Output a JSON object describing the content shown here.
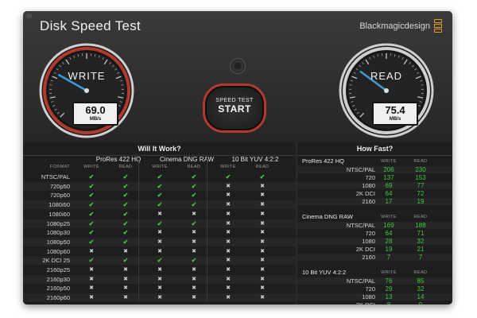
{
  "window": {
    "title": "Disk Speed Test",
    "brand": "Blackmagicdesign",
    "accent_red": "#b23a2d",
    "needle_blue": "#3f9bd8",
    "check_green": "#3ec93e",
    "icons": {
      "settings": "gear-icon",
      "close": "close-icon",
      "logo": "brand-logo-icon"
    }
  },
  "write_gauge": {
    "label": "WRITE",
    "value": "69.0",
    "unit": "MB/s"
  },
  "read_gauge": {
    "label": "READ",
    "value": "75.4",
    "unit": "MB/s"
  },
  "start_button": {
    "line1": "SPEED TEST",
    "line2": "START"
  },
  "will_it_work": {
    "title": "Will It Work?",
    "format_header": "FORMAT",
    "groups": [
      {
        "name": "ProRes 422 HQ",
        "write": "WRITE",
        "read": "READ"
      },
      {
        "name": "Cinema DNG RAW",
        "write": "WRITE",
        "read": "READ"
      },
      {
        "name": "10 Bit YUV 4:2:2",
        "write": "WRITE",
        "read": "READ"
      }
    ],
    "rows": [
      {
        "format": "NTSC/PAL",
        "marks": [
          "✔",
          "✔",
          "✔",
          "✔",
          "✔",
          "✔"
        ]
      },
      {
        "format": "720p50",
        "marks": [
          "✔",
          "✔",
          "✔",
          "✔",
          "✖",
          "✖"
        ]
      },
      {
        "format": "720p60",
        "marks": [
          "✔",
          "✔",
          "✔",
          "✔",
          "✖",
          "✖"
        ]
      },
      {
        "format": "1080i50",
        "marks": [
          "✔",
          "✔",
          "✔",
          "✔",
          "✖",
          "✖"
        ]
      },
      {
        "format": "1080i60",
        "marks": [
          "✔",
          "✔",
          "✖",
          "✖",
          "✖",
          "✖"
        ]
      },
      {
        "format": "1080p25",
        "marks": [
          "✔",
          "✔",
          "✔",
          "✔",
          "✖",
          "✖"
        ]
      },
      {
        "format": "1080p30",
        "marks": [
          "✔",
          "✔",
          "✖",
          "✖",
          "✖",
          "✖"
        ]
      },
      {
        "format": "1080p50",
        "marks": [
          "✔",
          "✔",
          "✖",
          "✖",
          "✖",
          "✖"
        ]
      },
      {
        "format": "1080p60",
        "marks": [
          "✖",
          "✖",
          "✖",
          "✖",
          "✖",
          "✖"
        ]
      },
      {
        "format": "2K DCI 25",
        "marks": [
          "✔",
          "✔",
          "✔",
          "✔",
          "✖",
          "✖"
        ]
      },
      {
        "format": "2160p25",
        "marks": [
          "✖",
          "✖",
          "✖",
          "✖",
          "✖",
          "✖"
        ]
      },
      {
        "format": "2160p30",
        "marks": [
          "✖",
          "✖",
          "✖",
          "✖",
          "✖",
          "✖"
        ]
      },
      {
        "format": "2160p50",
        "marks": [
          "✖",
          "✖",
          "✖",
          "✖",
          "✖",
          "✖"
        ]
      },
      {
        "format": "2160p60",
        "marks": [
          "✖",
          "✖",
          "✖",
          "✖",
          "✖",
          "✖"
        ]
      }
    ]
  },
  "how_fast": {
    "title": "How Fast?",
    "groups": [
      {
        "name": "ProRes 422 HQ",
        "write": "WRITE",
        "read": "READ",
        "rows": [
          {
            "format": "NTSC/PAL",
            "write": "206",
            "read": "230"
          },
          {
            "format": "720",
            "write": "137",
            "read": "153"
          },
          {
            "format": "1080",
            "write": "69",
            "read": "77"
          },
          {
            "format": "2K DCI",
            "write": "64",
            "read": "72"
          },
          {
            "format": "2160",
            "write": "17",
            "read": "19"
          }
        ]
      },
      {
        "name": "Cinema DNG RAW",
        "write": "WRITE",
        "read": "READ",
        "rows": [
          {
            "format": "NTSC/PAL",
            "write": "169",
            "read": "188"
          },
          {
            "format": "720",
            "write": "64",
            "read": "71"
          },
          {
            "format": "1080",
            "write": "28",
            "read": "32"
          },
          {
            "format": "2K DCI",
            "write": "19",
            "read": "21"
          },
          {
            "format": "2160",
            "write": "7",
            "read": "7"
          }
        ]
      },
      {
        "name": "10 Bit YUV 4:2:2",
        "write": "WRITE",
        "read": "READ",
        "rows": [
          {
            "format": "NTSC/PAL",
            "write": "76",
            "read": "85"
          },
          {
            "format": "720",
            "write": "29",
            "read": "32"
          },
          {
            "format": "1080",
            "write": "13",
            "read": "14"
          },
          {
            "format": "2K DCI",
            "write": "8",
            "read": "9"
          },
          {
            "format": "2160",
            "write": "3",
            "read": "3"
          }
        ]
      }
    ]
  }
}
